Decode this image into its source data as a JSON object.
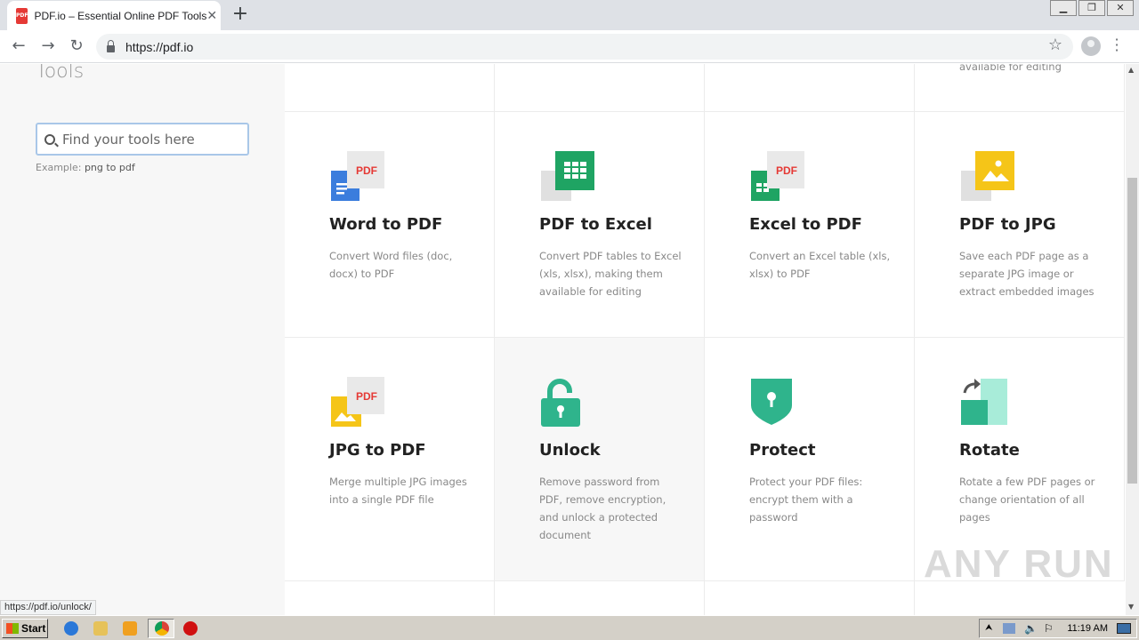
{
  "browser": {
    "tab_title": "PDF.io – Essential Online PDF Tools",
    "favicon_text": "PDF",
    "close_tab": "✕",
    "new_tab": "+",
    "url": "https://pdf.io",
    "status_url": "https://pdf.io/unlock/"
  },
  "sidebar": {
    "title": "Tools",
    "search_placeholder": "Find your tools here",
    "example_label": "Example:",
    "example_value": "png to pdf"
  },
  "top_row": {
    "desc_fragment": "available for editing"
  },
  "tools": [
    {
      "title": "Word to PDF",
      "desc": "Convert Word files (doc, docx) to PDF",
      "icon": "word-to-pdf-icon"
    },
    {
      "title": "PDF to Excel",
      "desc": "Convert PDF tables to Excel (xls, xlsx), making them available for editing",
      "icon": "pdf-to-excel-icon"
    },
    {
      "title": "Excel to PDF",
      "desc": "Convert an Excel table (xls, xlsx) to PDF",
      "icon": "excel-to-pdf-icon"
    },
    {
      "title": "PDF to JPG",
      "desc": "Save each PDF page as a separate JPG image or extract embedded images",
      "icon": "pdf-to-jpg-icon"
    },
    {
      "title": "JPG to PDF",
      "desc": "Merge multiple JPG images into a single PDF file",
      "icon": "jpg-to-pdf-icon"
    },
    {
      "title": "Unlock",
      "desc": "Remove password from PDF, remove encryption, and unlock a protected document",
      "icon": "unlock-icon"
    },
    {
      "title": "Protect",
      "desc": "Protect your PDF files: encrypt them with a password",
      "icon": "protect-icon"
    },
    {
      "title": "Rotate",
      "desc": "Rotate a few PDF pages or change orientation of all pages",
      "icon": "rotate-icon"
    }
  ],
  "taskbar": {
    "start_label": "Start",
    "clock": "11:19 AM"
  },
  "watermark": "ANY RUN",
  "colors": {
    "word_blue": "#3b7ddd",
    "sheets_green": "#1fa463",
    "jpg_yellow": "#f5c518",
    "pdf_red": "#e53935",
    "teal": "#2fb48c",
    "mint": "#a8ecd9"
  }
}
